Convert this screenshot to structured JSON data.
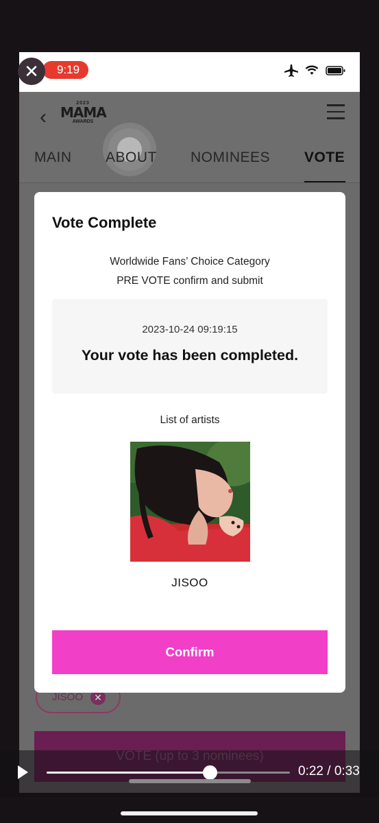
{
  "status_bar": {
    "time": "9:19"
  },
  "header": {
    "logo": {
      "year": "2023",
      "name": "MAMA",
      "sub": "AWARDS"
    },
    "tabs": [
      {
        "label": "MAIN"
      },
      {
        "label": "ABOUT"
      },
      {
        "label": "NOMINEES"
      },
      {
        "label": "VOTE",
        "active": true
      }
    ]
  },
  "background": {
    "selected_chip": "JISOO",
    "vote_button": "VOTE (up to 3 nominees)"
  },
  "modal": {
    "title": "Vote Complete",
    "subtitle_line1": "Worldwide Fans’ Choice Category",
    "subtitle_line2": "PRE VOTE confirm and submit",
    "timestamp": "2023-10-24 09:19:15",
    "message": "Your vote has been completed.",
    "list_label": "List of artists",
    "artist_name": "JISOO",
    "confirm_label": "Confirm"
  },
  "video_player": {
    "current_time": "0:22",
    "duration": "0:33",
    "progress": 0.67
  },
  "colors": {
    "accent": "#f23fc8",
    "overlay": "#6b6b6b",
    "record_pill": "#e63a2f"
  }
}
